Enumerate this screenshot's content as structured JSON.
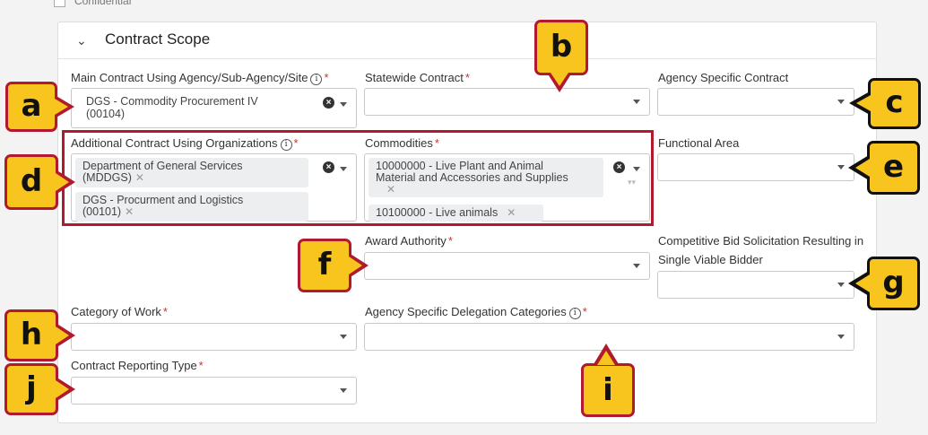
{
  "top_checkbox_label": "Confidential",
  "section": {
    "title": "Contract Scope"
  },
  "fields": {
    "main_agency": {
      "label": "Main Contract Using Agency/Sub-Agency/Site",
      "value_line1": "DGS - Commodity Procurement IV",
      "value_line2": "(00104)"
    },
    "statewide": {
      "label": "Statewide Contract"
    },
    "agency_specific": {
      "label": "Agency Specific Contract"
    },
    "additional_orgs": {
      "label": "Additional Contract Using Organizations",
      "tags": [
        {
          "line1": "Department of General Services",
          "line2": "(MDDGS)"
        },
        {
          "line1": "DGS - Procurment and Logistics",
          "line2": "(00101)"
        }
      ]
    },
    "commodities": {
      "label": "Commodities",
      "tags": [
        {
          "line1": "10000000 - Live Plant and Animal",
          "line2": "Material and Accessories and Supplies"
        },
        {
          "line1": "10100000 - Live animals"
        }
      ]
    },
    "functional_area": {
      "label": "Functional Area"
    },
    "award_authority": {
      "label": "Award Authority"
    },
    "competitive_bid": {
      "label": "Competitive Bid Solicitation Resulting in Single Viable Bidder"
    },
    "category_of_work": {
      "label": "Category of Work"
    },
    "delegation_categories": {
      "label": "Agency Specific Delegation Categories"
    },
    "reporting_type": {
      "label": "Contract Reporting Type"
    }
  },
  "callouts": {
    "a": "a",
    "b": "b",
    "c": "c",
    "d": "d",
    "e": "e",
    "f": "f",
    "g": "g",
    "h": "h",
    "i": "i",
    "j": "j"
  },
  "colors": {
    "callout_fill": "#f7c51e",
    "callout_border_red": "#b0192e",
    "callout_border_black": "#111111",
    "required": "#c0392b"
  }
}
